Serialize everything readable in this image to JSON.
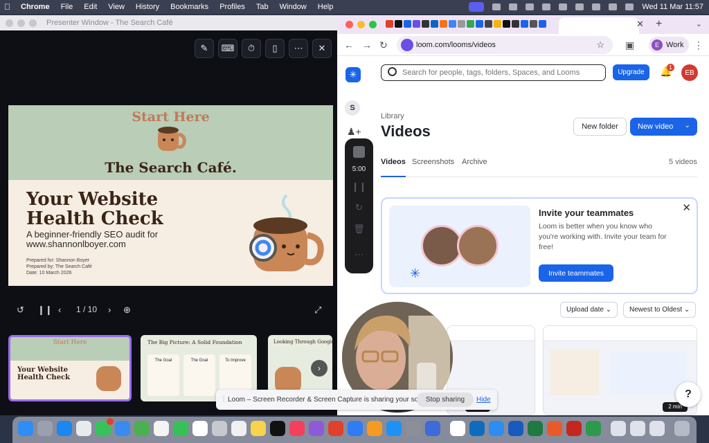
{
  "menubar": {
    "app": "Chrome",
    "items": [
      "File",
      "Edit",
      "View",
      "History",
      "Bookmarks",
      "Profiles",
      "Tab",
      "Window",
      "Help"
    ],
    "datetime": "Wed 11 Mar  11:57"
  },
  "presenter": {
    "title": "Presenter Window - The Search Café",
    "slide": {
      "kicker": "Start Here",
      "brand": "The Search Café.",
      "headline_line1": "Your Website",
      "headline_line2": "Health Check",
      "subtitle_line1": "A beginner-friendly SEO audit for",
      "subtitle_line2": "www.shannonlboyer.com",
      "prepared_for": "Prepared for: Shannon Boyer",
      "prepared_by": "Prepared by: The Search Café",
      "date": "Date: 10 March 2026"
    },
    "page_indicator": "1 / 10",
    "thumbnails": [
      {
        "title": "Start Here",
        "subtitle": "Your Website Health Check"
      },
      {
        "title": "The Big Picture: A Solid Foundation",
        "cols": [
          "The Goal",
          "The Goal",
          "To Improve"
        ]
      },
      {
        "title": "Looking Through Google's Eyes"
      }
    ]
  },
  "browser": {
    "url": "loom.com/looms/videos",
    "profile_label": "Work",
    "profile_initial": "E"
  },
  "loom": {
    "search_placeholder": "Search for people, tags, folders, Spaces, and Looms",
    "upgrade_label": "Upgrade",
    "notification_count": "1",
    "user_initials": "EB",
    "space_initial": "S",
    "library_label": "Library",
    "page_title": "Videos",
    "new_folder_label": "New folder",
    "new_video_label": "New video",
    "tabs": [
      "Videos",
      "Screenshots",
      "Archive"
    ],
    "video_count": "5 videos",
    "invite": {
      "title": "Invite your teammates",
      "body": "Loom is better when you know who you're working with. Invite your team for free!",
      "button": "Invite teammates"
    },
    "sort_by": "Upload date",
    "sort_order": "Newest to Oldest",
    "thumb_duration": "2 min"
  },
  "recorder": {
    "timer": "5:00"
  },
  "sharing_bar": {
    "message": "Loom – Screen Recorder & Screen Capture is sharing your screen.",
    "stop_label": "Stop sharing",
    "hide_label": "Hide"
  },
  "help_label": "?",
  "colors": {
    "loom_blue": "#1a64e8",
    "slide_green": "#b9cdb7",
    "slide_cream": "#f6ede3",
    "slide_brown": "#3a2416",
    "slide_accent": "#c0795a"
  }
}
